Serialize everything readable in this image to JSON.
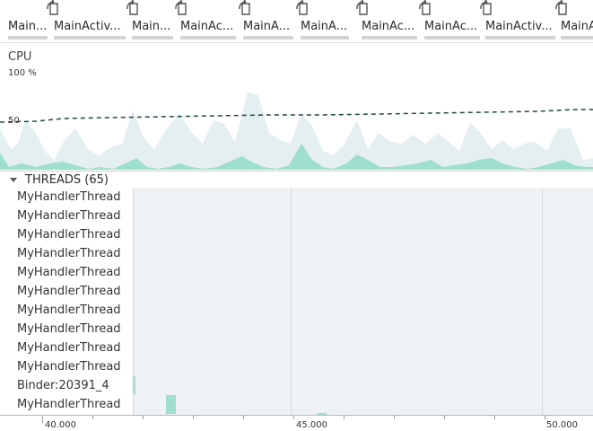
{
  "events": [
    {
      "label": "Main..."
    },
    {
      "label": "MainActiv..."
    },
    {
      "label": "Main..."
    },
    {
      "label": "MainAc..."
    },
    {
      "label": "MainA..."
    },
    {
      "label": "MainA..."
    },
    {
      "label": "MainAc..."
    },
    {
      "label": "MainAc..."
    },
    {
      "label": "MainActiv..."
    },
    {
      "label": "MainA..."
    }
  ],
  "cpu": {
    "title": "CPU",
    "max_label": "100 %",
    "mid_label": "50"
  },
  "threads": {
    "header": "THREADS (65)",
    "items": [
      "MyHandlerThread",
      "MyHandlerThread",
      "MyHandlerThread",
      "MyHandlerThread",
      "MyHandlerThread",
      "MyHandlerThread",
      "MyHandlerThread",
      "MyHandlerThread",
      "MyHandlerThread",
      "MyHandlerThread",
      "Binder:20391_4",
      "MyHandlerThread"
    ]
  },
  "axis": {
    "labels": [
      "40.000",
      "45.000",
      "50.000"
    ]
  },
  "colors": {
    "cpu_app": "#9edfd0",
    "cpu_other": "#e5eff2",
    "thread_count_line": "#1f4a47",
    "track_background": "#eef2f5"
  }
}
